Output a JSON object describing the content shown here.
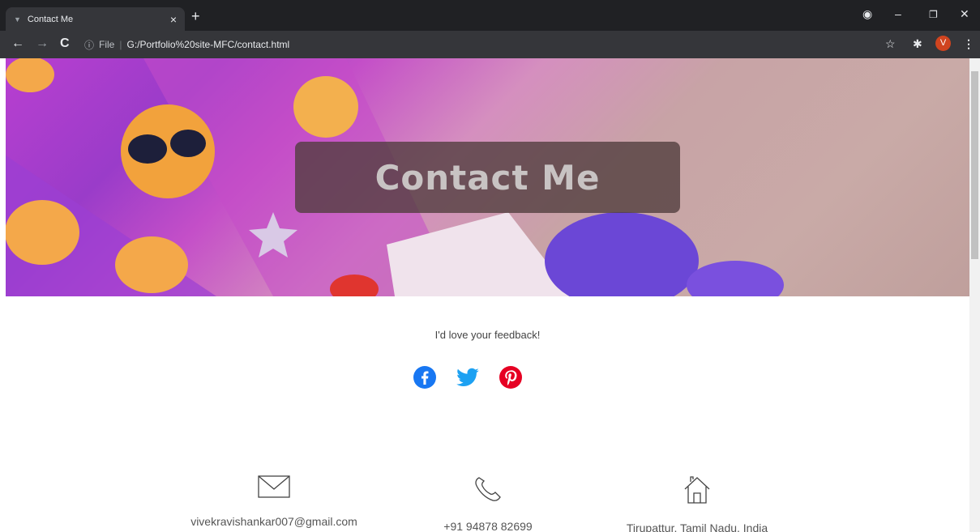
{
  "browser": {
    "tab_title": "Contact Me",
    "tab_close": "×",
    "new_tab": "+",
    "url_scheme_label": "File",
    "url": "G:/Portfolio%20site-MFC/contact.html",
    "profile_initial": "V"
  },
  "hero": {
    "title": "Contact Me"
  },
  "feedback": {
    "text": "I'd love your feedback!"
  },
  "social": [
    {
      "name": "facebook",
      "color": "#1877f2"
    },
    {
      "name": "twitter",
      "color": "#1da1f2"
    },
    {
      "name": "pinterest",
      "color": "#e60023"
    }
  ],
  "contact": {
    "email": "vivekravishankar007@gmail.com",
    "phone": "+91 94878 82699",
    "address": "Tirupattur, Tamil Nadu, India"
  }
}
